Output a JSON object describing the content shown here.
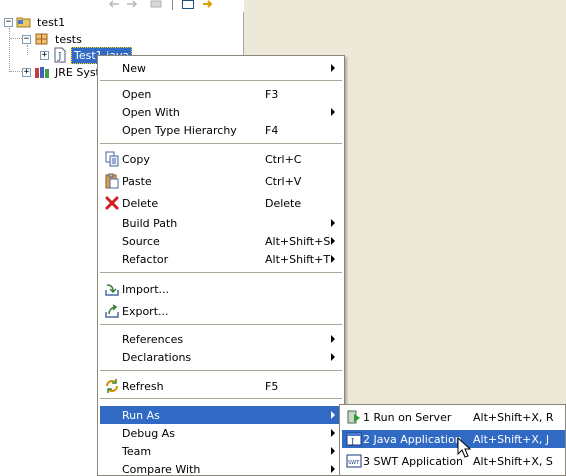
{
  "tree": {
    "items": [
      {
        "label": "test1",
        "icon": "project-folder-icon",
        "expander": "−"
      },
      {
        "label": "tests",
        "icon": "package-icon",
        "expander": "−"
      },
      {
        "label": "Test1.java",
        "icon": "java-file-icon",
        "expander": "+"
      },
      {
        "label": "JRE Syst",
        "icon": "library-icon",
        "expander": "+"
      }
    ]
  },
  "context_menu": {
    "items": [
      {
        "label": "New",
        "shortcut": "",
        "submenu": true,
        "icon": ""
      },
      {
        "label": "Open",
        "shortcut": "F3",
        "submenu": false,
        "icon": ""
      },
      {
        "label": "Open With",
        "shortcut": "",
        "submenu": true,
        "icon": ""
      },
      {
        "label": "Open Type Hierarchy",
        "shortcut": "F4",
        "submenu": false,
        "icon": ""
      },
      {
        "label": "Copy",
        "shortcut": "Ctrl+C",
        "submenu": false,
        "icon": "copy-icon"
      },
      {
        "label": "Paste",
        "shortcut": "Ctrl+V",
        "submenu": false,
        "icon": "paste-icon"
      },
      {
        "label": "Delete",
        "shortcut": "Delete",
        "submenu": false,
        "icon": "delete-icon"
      },
      {
        "label": "Build Path",
        "shortcut": "",
        "submenu": true,
        "icon": ""
      },
      {
        "label": "Source",
        "shortcut": "Alt+Shift+S",
        "submenu": true,
        "icon": ""
      },
      {
        "label": "Refactor",
        "shortcut": "Alt+Shift+T",
        "submenu": true,
        "icon": ""
      },
      {
        "label": "Import...",
        "shortcut": "",
        "submenu": false,
        "icon": "import-icon"
      },
      {
        "label": "Export...",
        "shortcut": "",
        "submenu": false,
        "icon": "export-icon"
      },
      {
        "label": "References",
        "shortcut": "",
        "submenu": true,
        "icon": ""
      },
      {
        "label": "Declarations",
        "shortcut": "",
        "submenu": true,
        "icon": ""
      },
      {
        "label": "Refresh",
        "shortcut": "F5",
        "submenu": false,
        "icon": "refresh-icon"
      },
      {
        "label": "Run As",
        "shortcut": "",
        "submenu": true,
        "icon": "",
        "highlighted": true
      },
      {
        "label": "Debug As",
        "shortcut": "",
        "submenu": true,
        "icon": ""
      },
      {
        "label": "Team",
        "shortcut": "",
        "submenu": true,
        "icon": ""
      },
      {
        "label": "Compare With",
        "shortcut": "",
        "submenu": true,
        "icon": ""
      }
    ]
  },
  "run_as_submenu": {
    "items": [
      {
        "label": "1 Run on Server",
        "shortcut": "Alt+Shift+X, R",
        "icon": "run-on-server-icon"
      },
      {
        "label": "2 Java Application",
        "shortcut": "Alt+Shift+X, J",
        "icon": "java-application-icon",
        "highlighted": true
      },
      {
        "label": "3 SWT Application",
        "shortcut": "Alt+Shift+X, S",
        "icon": "swt-application-icon"
      }
    ]
  },
  "colors": {
    "highlight": "#316ac5",
    "menu_background": "#ffffff",
    "workspace_background": "#ece9d8"
  }
}
